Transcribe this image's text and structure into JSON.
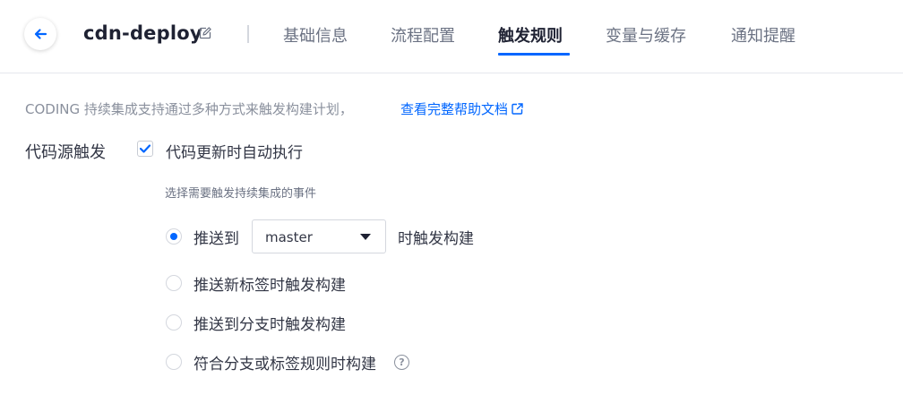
{
  "header": {
    "title": "cdn-deploy",
    "tabs": [
      {
        "label": "基础信息",
        "active": false
      },
      {
        "label": "流程配置",
        "active": false
      },
      {
        "label": "触发规则",
        "active": true
      },
      {
        "label": "变量与缓存",
        "active": false
      },
      {
        "label": "通知提醒",
        "active": false
      }
    ]
  },
  "description": {
    "text": "CODING 持续集成支持通过多种方式来触发构建计划，",
    "link_label": "查看完整帮助文档"
  },
  "trigger": {
    "section_label": "代码源触发",
    "auto_run_label": "代码更新时自动执行",
    "auto_run_checked": true,
    "event_hint": "选择需要触发持续集成的事件",
    "options": [
      {
        "label": "推送到",
        "checked": true
      },
      {
        "label": "推送新标签时触发构建",
        "checked": false
      },
      {
        "label": "推送到分支时触发构建",
        "checked": false
      },
      {
        "label": "符合分支或标签规则时构建",
        "checked": false
      }
    ],
    "branch_select_value": "master",
    "branch_suffix": "时触发构建",
    "help_glyph": "?"
  },
  "colors": {
    "accent": "#0066ff",
    "text_primary": "#323645",
    "text_muted": "#8a909d"
  }
}
